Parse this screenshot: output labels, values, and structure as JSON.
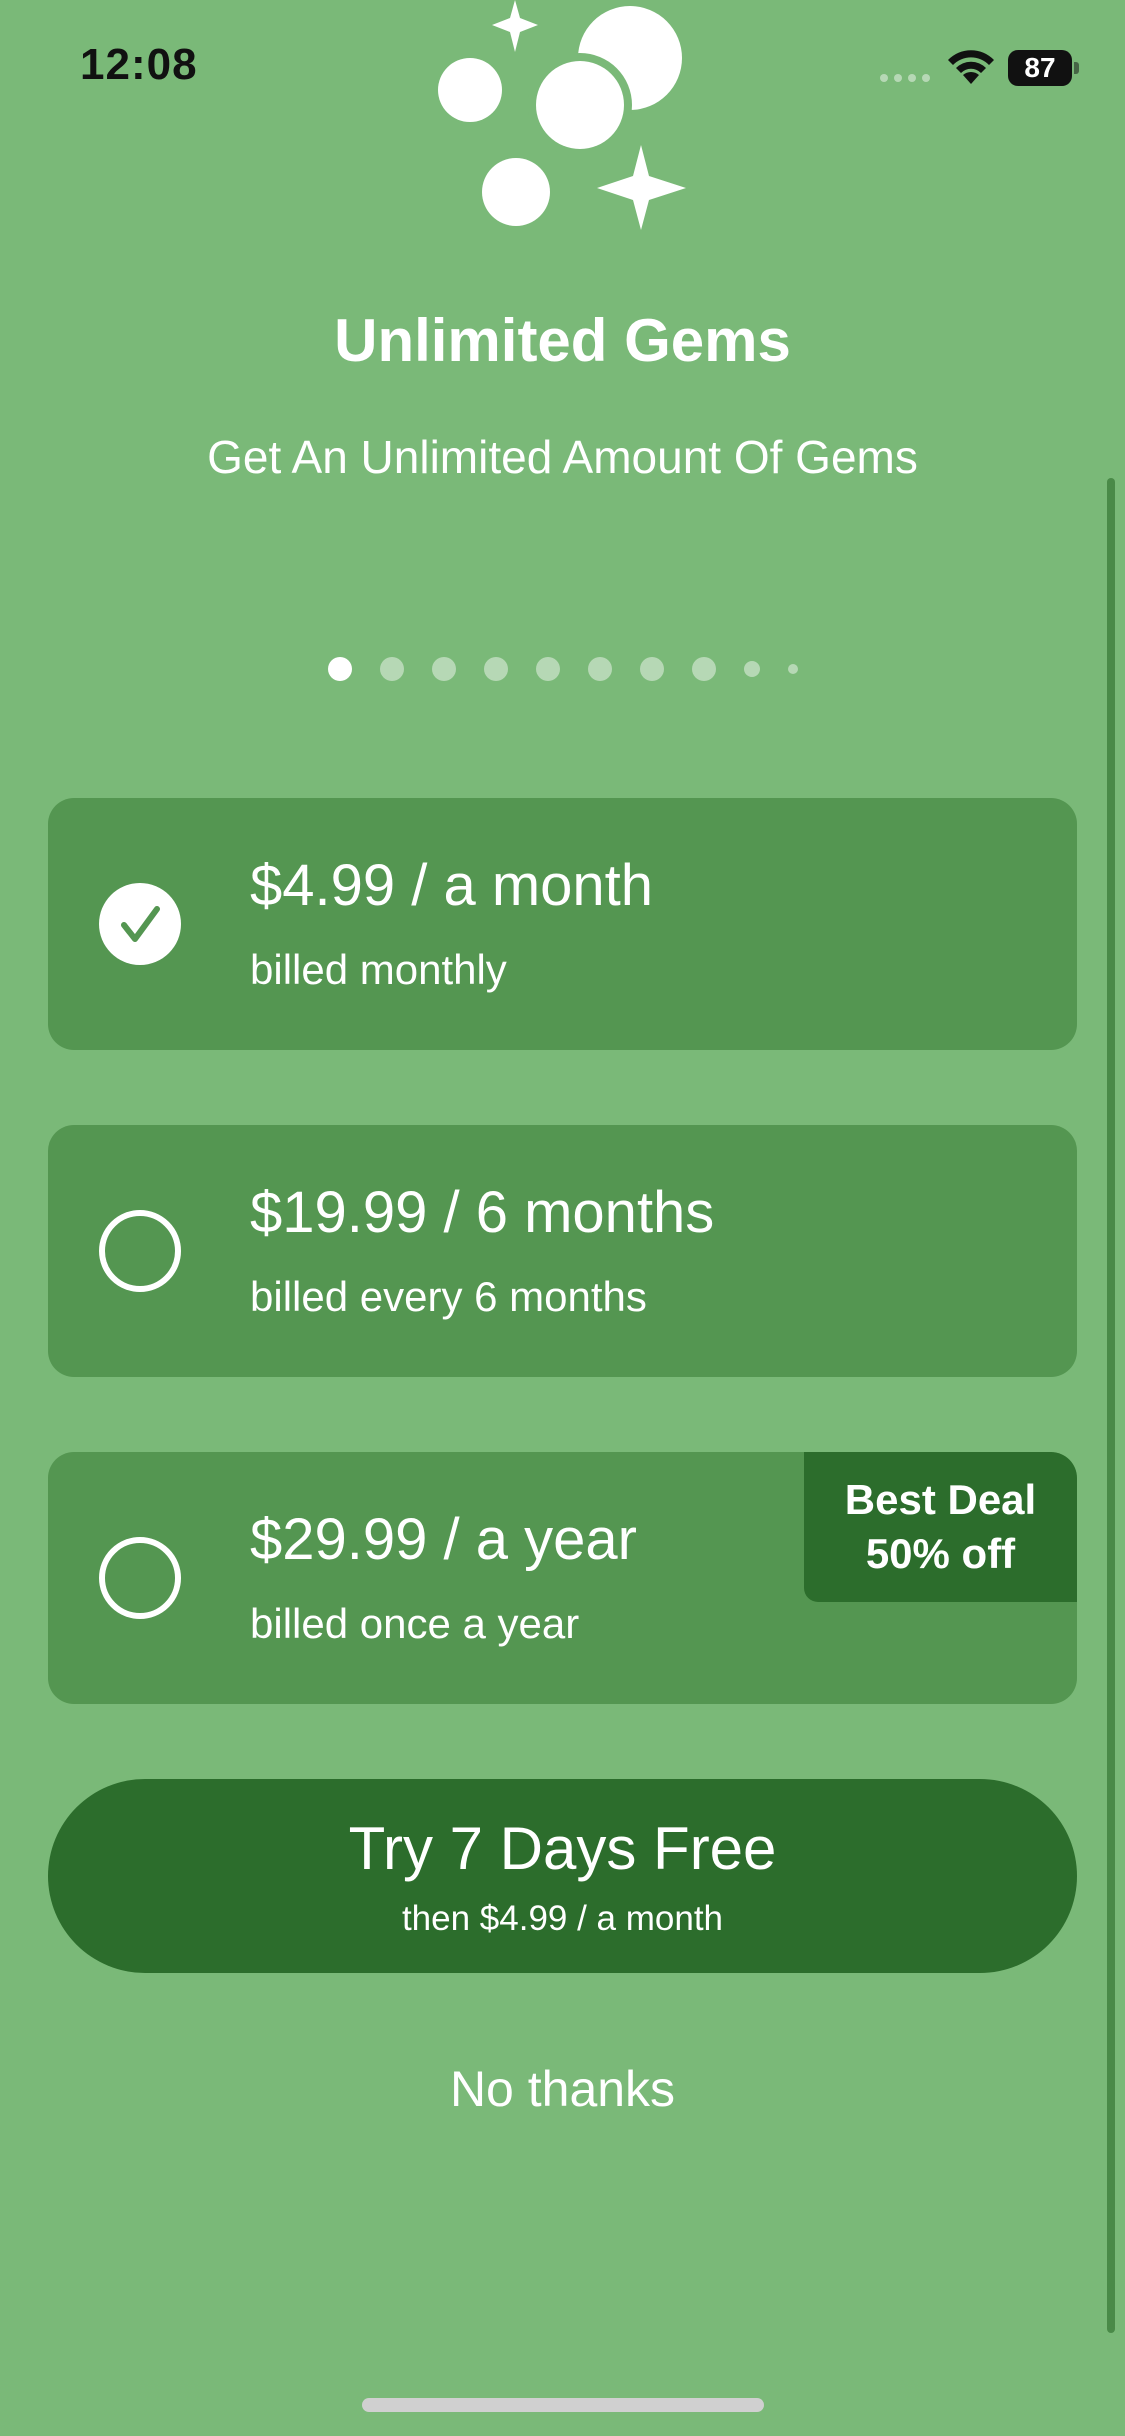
{
  "status_bar": {
    "time": "12:08",
    "battery": "87"
  },
  "hero": {
    "icon": "sparkle-gems-icon",
    "title": "Unlimited Gems",
    "subtitle": "Get An Unlimited Amount Of Gems"
  },
  "pager": {
    "total_dots": 10,
    "active_index": 0
  },
  "plans": [
    {
      "price": "$4.99 / a month",
      "billing": "billed monthly",
      "selected": true
    },
    {
      "price": "$19.99 / 6 months",
      "billing": "billed every 6 months",
      "selected": false
    },
    {
      "price": "$29.99 / a year",
      "billing": "billed once a year",
      "selected": false,
      "badge": {
        "line1": "Best Deal",
        "line2": "50% off"
      }
    }
  ],
  "cta": {
    "label": "Try 7 Days Free",
    "sublabel": "then $4.99 / a month"
  },
  "decline": {
    "label": "No thanks"
  },
  "colors": {
    "background": "#7ab978",
    "card": "#549651",
    "accent_dark": "#2c6d2c",
    "text": "#ffffff"
  }
}
